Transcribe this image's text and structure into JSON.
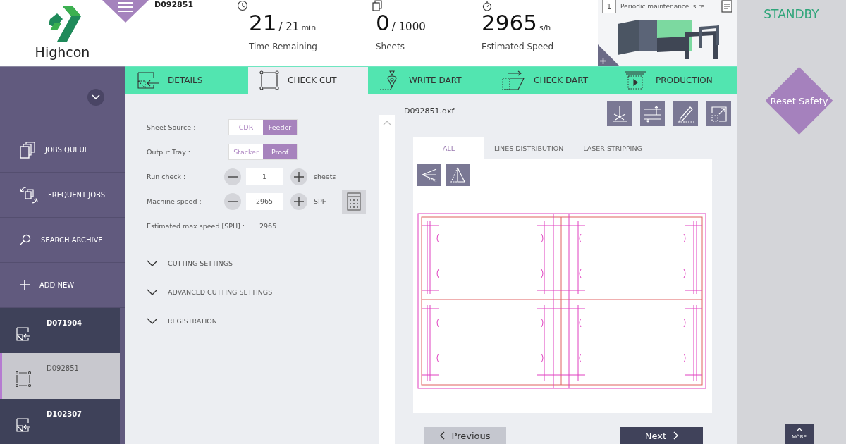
{
  "header": {
    "logo_text": "Highcon",
    "job_id": "D092851",
    "stats": [
      {
        "kind": "time",
        "value": "21",
        "total": "/ 21",
        "unit": "min",
        "label": "Time Remaining"
      },
      {
        "kind": "sheets",
        "value": "0",
        "total": "/ 1000",
        "label": "Sheets"
      },
      {
        "kind": "speed",
        "value": "2965",
        "unit": "s/h",
        "label": "Estimated Speed"
      }
    ],
    "maintenance": {
      "count": "1",
      "message": "Periodic maintenance is re..."
    },
    "status": "STANDBY"
  },
  "sidebar": {
    "nav": [
      {
        "kind": "queue",
        "label": "JOBS QUEUE"
      },
      {
        "kind": "frequent",
        "label": "FREQUENT JOBS"
      },
      {
        "kind": "search",
        "label": "SEARCH ARCHIVE"
      },
      {
        "kind": "add",
        "label": "ADD NEW"
      }
    ],
    "jobs": [
      {
        "id": "D071904",
        "kind": "details",
        "selected": false
      },
      {
        "id": "D092851",
        "kind": "checkcut",
        "selected": true
      },
      {
        "id": "D102307",
        "kind": "details",
        "selected": false
      }
    ]
  },
  "tabs": [
    {
      "kind": "details",
      "label": "DETAILS",
      "selected": false
    },
    {
      "kind": "checkcut",
      "label": "CHECK CUT",
      "selected": true
    },
    {
      "kind": "writedart",
      "label": "WRITE DART",
      "selected": false
    },
    {
      "kind": "checkdart",
      "label": "CHECK DART",
      "selected": false
    },
    {
      "kind": "production",
      "label": "PRODUCTION",
      "selected": false
    }
  ],
  "settings": {
    "toggles": [
      {
        "label": "Sheet Source :",
        "options": [
          {
            "label": "CDR",
            "selected": false
          },
          {
            "label": "Feeder",
            "selected": true
          }
        ]
      },
      {
        "label": "Output Tray :",
        "options": [
          {
            "label": "Stacker",
            "selected": false
          },
          {
            "label": "Proof",
            "selected": true
          }
        ]
      }
    ],
    "steppers": [
      {
        "label": "Run check :",
        "value": "1",
        "unit": "sheets",
        "calculator": false
      },
      {
        "label": "Machine speed :",
        "value": "2965",
        "unit": "SPH",
        "calculator": true
      }
    ],
    "estimate": {
      "label": "Estimated max speed [SPH] :",
      "value": "2965"
    },
    "sections": [
      {
        "label": "CUTTING SETTINGS"
      },
      {
        "label": "ADVANCED CUTTING SETTINGS"
      },
      {
        "label": "REGISTRATION"
      }
    ]
  },
  "viewer": {
    "filename": "D092851.dxf",
    "view_tabs": [
      {
        "label": "ALL",
        "selected": true
      },
      {
        "label": "LINES DISTRIBUTION",
        "selected": false
      },
      {
        "label": "LASER STRIPPING",
        "selected": false
      }
    ]
  },
  "buttons": {
    "previous": "Previous",
    "next": "Next",
    "more": "MORE",
    "reset": "Reset Safety"
  }
}
